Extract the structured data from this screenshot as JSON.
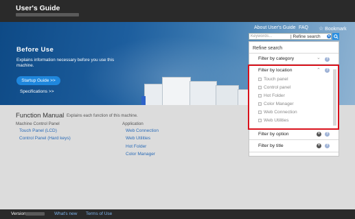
{
  "header": {
    "title": "User's Guide"
  },
  "nav": {
    "about": "About User's Guide",
    "faq": "FAQ",
    "bookmark": "Bookmark",
    "bookmark_icon": "☆"
  },
  "search": {
    "placeholder": "Keywords...",
    "refine_label": "| Refine search",
    "search_icon": "🔍"
  },
  "hero": {
    "heading": "Before Use",
    "description": "Explains information necessary before you use this machine.",
    "startup_button": "Startup Guide >>",
    "specifications_link": "Specifications >>"
  },
  "function_manual": {
    "title": "Function Manual",
    "description": "Explains each function of this machine.",
    "columns": [
      {
        "heading": "Machine Control Panel",
        "links": [
          "Touch Panel (LCD)",
          "Control Panel (Hard keys)"
        ]
      },
      {
        "heading": "Application",
        "links": [
          "Web Connection",
          "Web Utilities",
          "Hot Folder",
          "Color Manager"
        ]
      }
    ]
  },
  "refine_panel": {
    "heading": "Refine search",
    "filter_category": "Filter by category",
    "filter_location": "Filter by location",
    "locations": [
      "Touch panel",
      "Control panel",
      "Hot Folder",
      "Color Manager",
      "Web Connection",
      "Web Utilities"
    ],
    "filter_option": "Filter by option",
    "filter_title": "Filter by title",
    "help_glyph": "?",
    "plus_glyph": "+",
    "chevron_down_glyph": "⌄",
    "chevron_up_glyph": "⌃"
  },
  "footer": {
    "version_label": "Version",
    "whats_new": "What's new",
    "terms": "Terms of Use"
  },
  "colors": {
    "accent": "#1f87dd",
    "highlight": "#d9101a",
    "header_bg": "#2a2a2a"
  }
}
